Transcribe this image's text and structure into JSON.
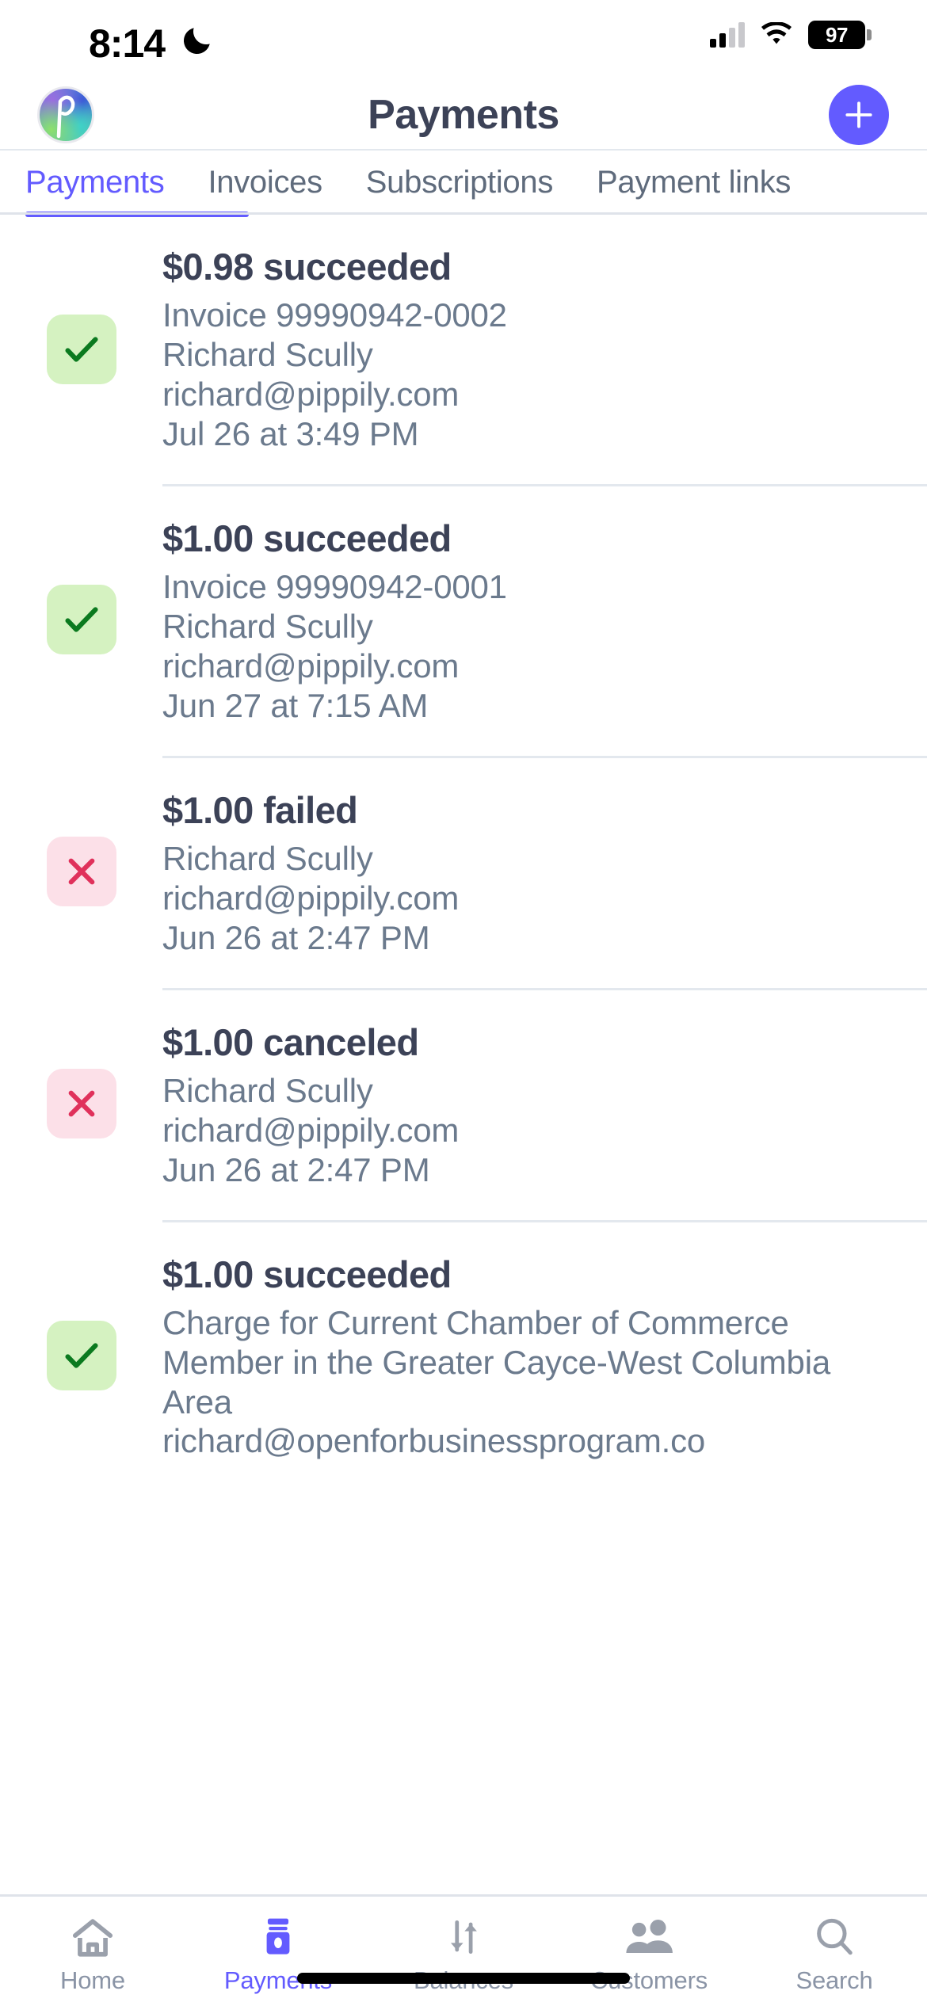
{
  "status_bar": {
    "time": "8:14",
    "moon_icon": "crescent-moon-icon",
    "cellular_icon": "cellular-signal-icon",
    "wifi_icon": "wifi-icon",
    "battery_percent": "97"
  },
  "nav": {
    "title": "Payments",
    "avatar_icon": "account-avatar",
    "add_button_icon": "plus-icon",
    "accent_color": "#635bff"
  },
  "segments": {
    "items": [
      {
        "label": "Payments",
        "active": true
      },
      {
        "label": "Invoices",
        "active": false
      },
      {
        "label": "Subscriptions",
        "active": false
      },
      {
        "label": "Payment links",
        "active": false
      }
    ]
  },
  "payments": [
    {
      "status_icon": "check-icon",
      "status": "succeeded",
      "amount": "$0.98",
      "title": "$0.98 succeeded",
      "description": "Invoice 99990942-0002",
      "customer": "Richard Scully",
      "email": "richard@pippily.com",
      "timestamp": "Jul 26 at 3:49 PM"
    },
    {
      "status_icon": "check-icon",
      "status": "succeeded",
      "amount": "$1.00",
      "title": "$1.00 succeeded",
      "description": "Invoice 99990942-0001",
      "customer": "Richard Scully",
      "email": "richard@pippily.com",
      "timestamp": "Jun 27 at 7:15 AM"
    },
    {
      "status_icon": "x-icon",
      "status": "failed",
      "amount": "$1.00",
      "title": "$1.00 failed",
      "description": "",
      "customer": "Richard Scully",
      "email": "richard@pippily.com",
      "timestamp": "Jun 26 at 2:47 PM"
    },
    {
      "status_icon": "x-icon",
      "status": "canceled",
      "amount": "$1.00",
      "title": "$1.00 canceled",
      "description": "",
      "customer": "Richard Scully",
      "email": "richard@pippily.com",
      "timestamp": "Jun 26 at 2:47 PM"
    },
    {
      "status_icon": "check-icon",
      "status": "succeeded",
      "amount": "$1.00",
      "title": "$1.00 succeeded",
      "description": "Charge for Current Chamber of Commerce Member in the Greater Cayce-West Columbia Area",
      "customer": "",
      "email": "richard@openforbusinessprogram.co",
      "timestamp": ""
    }
  ],
  "tab_bar": {
    "items": [
      {
        "label": "Home",
        "icon": "home-icon",
        "active": false
      },
      {
        "label": "Payments",
        "icon": "card-reader-icon",
        "active": true
      },
      {
        "label": "Balances",
        "icon": "transfer-arrows-icon",
        "active": false
      },
      {
        "label": "Customers",
        "icon": "people-icon",
        "active": false
      },
      {
        "label": "Search",
        "icon": "search-icon",
        "active": false
      }
    ]
  },
  "colors": {
    "accent": "#635bff",
    "success_bg": "#d5f2c1",
    "success_fg": "#0b7a1f",
    "error_bg": "#fce0e8",
    "error_fg": "#e0315b",
    "text_primary": "#3c4257",
    "text_secondary": "#6b7a8d"
  }
}
